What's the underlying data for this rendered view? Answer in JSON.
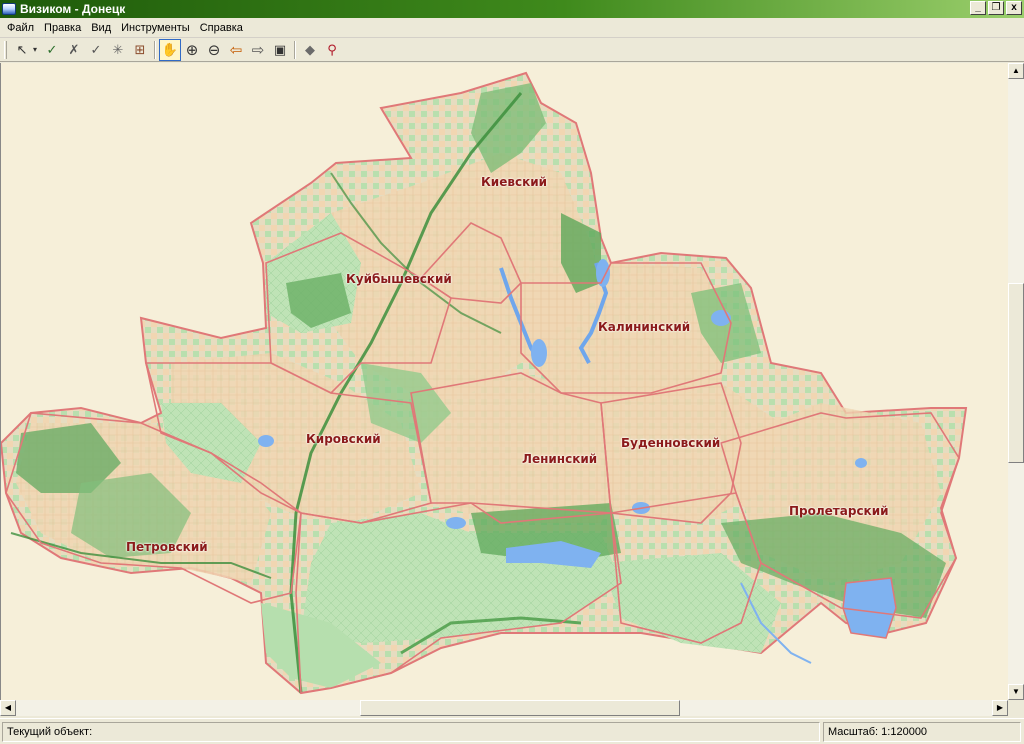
{
  "window": {
    "title": "Визиком - Донецк",
    "controls": [
      "_",
      "❐",
      "x"
    ]
  },
  "menu": {
    "items": [
      "Файл",
      "Правка",
      "Вид",
      "Инструменты",
      "Справка"
    ]
  },
  "toolbar": {
    "tools": [
      {
        "icon": "select-arrow-icon",
        "glyph": "↖"
      },
      {
        "icon": "dropdown-icon",
        "glyph": "▾"
      },
      {
        "icon": "select-list-icon",
        "glyph": "✓"
      },
      {
        "icon": "deselect-icon",
        "glyph": "✗"
      },
      {
        "icon": "select-add-icon",
        "glyph": "✓"
      },
      {
        "icon": "burst-icon",
        "glyph": "✳"
      },
      {
        "icon": "grid-select-icon",
        "glyph": "⊞"
      },
      {
        "icon": "hand-pan-icon",
        "glyph": "✋"
      },
      {
        "icon": "zoom-in-icon",
        "glyph": "⊕"
      },
      {
        "icon": "zoom-out-icon",
        "glyph": "⊖"
      },
      {
        "icon": "back-arrow-icon",
        "glyph": "⇦"
      },
      {
        "icon": "forward-arrow-icon",
        "glyph": "⇨"
      },
      {
        "icon": "full-extent-icon",
        "glyph": "▣"
      },
      {
        "icon": "layers-icon",
        "glyph": "◆"
      },
      {
        "icon": "search-map-icon",
        "glyph": "⚲"
      }
    ]
  },
  "map": {
    "districts": [
      {
        "label": "Киевский"
      },
      {
        "label": "Куйбышевский"
      },
      {
        "label": "Калининский"
      },
      {
        "label": "Кировский"
      },
      {
        "label": "Ленинский"
      },
      {
        "label": "Буденновский"
      },
      {
        "label": "Пролетарский"
      },
      {
        "label": "Петровский"
      }
    ],
    "colors": {
      "background": "#f6efd9",
      "urban": "#f2d9b8",
      "green_light": "#b9e2b4",
      "green_dark": "#5ea85a",
      "water": "#7fb2f0",
      "boundary": "#e07878",
      "label": "#8b1a1a"
    }
  },
  "status": {
    "current_object": "Текущий объект:",
    "scale": "Масштаб: 1:120000"
  }
}
